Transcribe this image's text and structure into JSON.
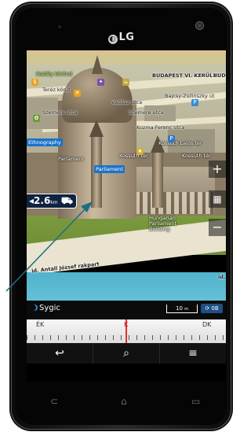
{
  "device": {
    "brand": "LG"
  },
  "map": {
    "labels": {
      "kodaly": "Kodály körönd",
      "terez": "Teréz körút",
      "budapest": "BUDAPEST VI. KERÜLET",
      "bud_short": "BUD",
      "bajcsy": "Bajcsy-Zsilinszky út",
      "vadasz": "Vadász utca",
      "szemere_l": "Szemere utca",
      "szemere_r": "Szemere utca",
      "kozma": "Kozma Ferenc utca",
      "ethnography": "Ethnography",
      "kossuth": "Kossuth tér",
      "kossuth2": "Kossuth Lajos tér",
      "kossuth3": "Kossuth tér",
      "parliament": "Parliament",
      "parliament_sub": "Parlament",
      "hungarian": "Hungarian Parliament Building",
      "rakpart": "id. Antall József rakpart",
      "id_right": "id."
    },
    "distance": {
      "value": "2.6",
      "unit": "km"
    },
    "controls": {
      "zoom_in": "+",
      "menu": "▦",
      "zoom_out": "−"
    },
    "bottom": {
      "logo": "Sygic",
      "scale": "10",
      "scale_unit": "m",
      "tracker": "0B"
    }
  },
  "compass": {
    "left": "ÉK",
    "center": "K",
    "right": "DK"
  },
  "nav": {
    "back": "↩",
    "search": "⌕",
    "menu": "≡"
  },
  "softkeys": {
    "back": "⊂",
    "home": "⌂",
    "recent": "▭"
  },
  "colors": {
    "accent": "#1b72c9",
    "water": "#4fb3cc",
    "lawn": "#7b9a3e",
    "arrow": "#1d6f86"
  }
}
